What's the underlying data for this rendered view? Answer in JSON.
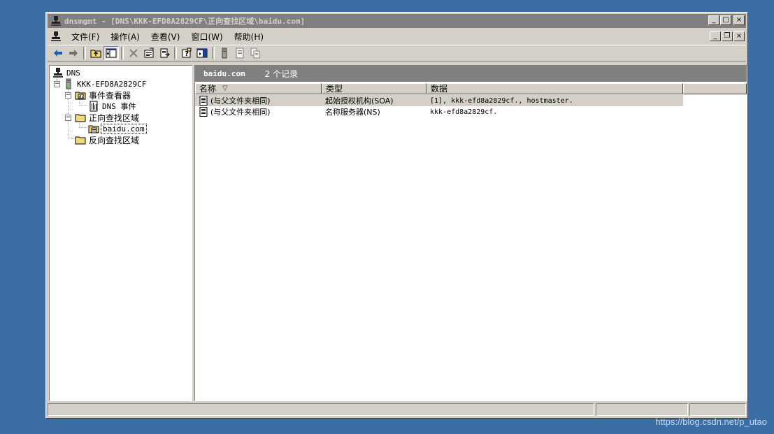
{
  "window": {
    "title": "dnsmgmt - [DNS\\KKK-EFD8A2829CF\\正向查找区域\\baidu.com]",
    "buttons": {
      "minimize": "_",
      "maximize": "□",
      "close": "×",
      "restore": "❐"
    }
  },
  "menu": {
    "items": [
      "文件(F)",
      "操作(A)",
      "查看(V)",
      "窗口(W)",
      "帮助(H)"
    ]
  },
  "toolbar": {
    "buttons": [
      "back-icon",
      "forward-icon",
      "up-folder-icon",
      "show-tree-icon",
      "delete-icon",
      "properties-icon",
      "export-icon",
      "help-icon",
      "action-pane-icon",
      "server-icon",
      "new-record-icon",
      "copy-icon"
    ]
  },
  "tree": {
    "root": "DNS",
    "server": "KKK-EFD8A2829CF",
    "event_viewer": "事件查看器",
    "dns_events": "DNS 事件",
    "forward_zones": "正向查找区域",
    "zone": "baidu.com",
    "reverse_zones": "反向查找区域"
  },
  "details": {
    "zone_name": "baidu.com",
    "record_count": "2 个记录",
    "columns": [
      "名称",
      "类型",
      "数据"
    ],
    "sort_indicator": "▽",
    "rows": [
      {
        "name": "(与父文件夹相同)",
        "type": "起始授权机构(SOA)",
        "data": "[1], kkk-efd8a2829cf., hostmaster."
      },
      {
        "name": "(与父文件夹相同)",
        "type": "名称服务器(NS)",
        "data": "kkk-efd8a2829cf."
      }
    ]
  },
  "watermark": "https://blog.csdn.net/p_utao",
  "colors": {
    "desktop": "#3a6ea5",
    "chrome": "#d4d0c8",
    "titlebar_inactive": "#808080",
    "pane_header": "#808080",
    "folder": "#f5d87a"
  }
}
